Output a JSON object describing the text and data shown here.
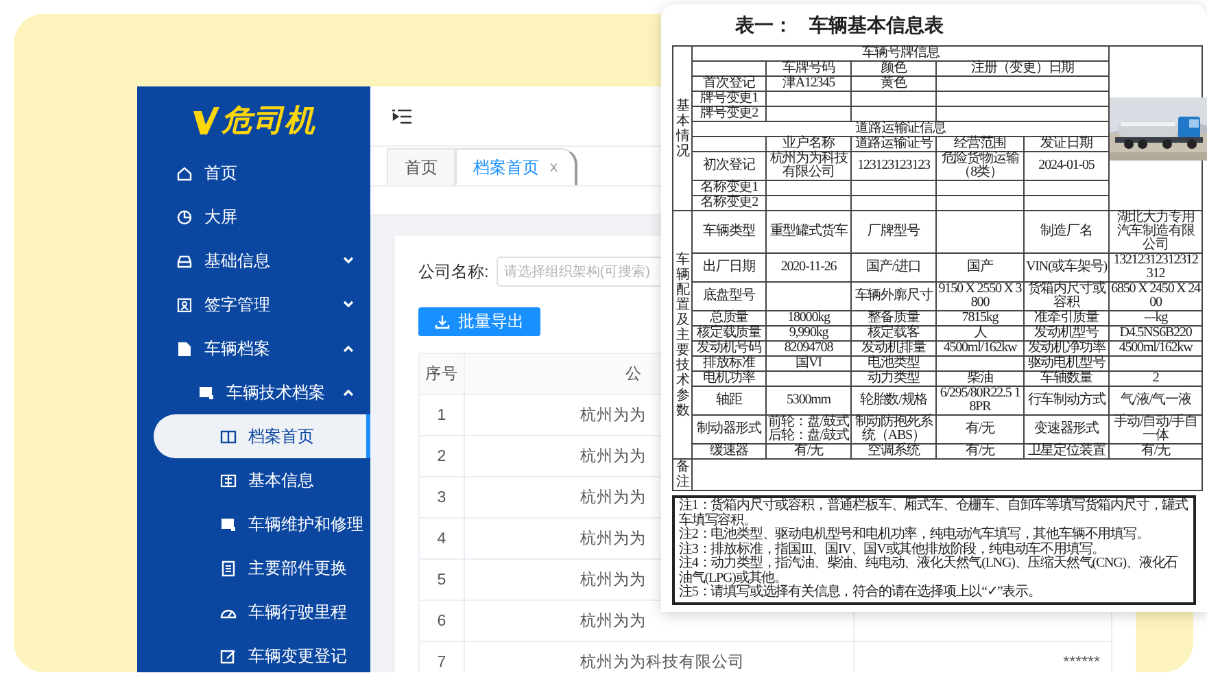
{
  "sidebar": {
    "logo": "危司机",
    "items": [
      {
        "label": "首页",
        "selected": false
      },
      {
        "label": "大屏",
        "selected": false
      },
      {
        "label": "基础信息",
        "selected": false,
        "expanded": false
      },
      {
        "label": "签字管理",
        "selected": false,
        "expanded": false
      },
      {
        "label": "车辆档案",
        "selected": false,
        "expanded": true,
        "children": [
          {
            "label": "车辆技术档案",
            "selected": false,
            "expanded": true,
            "children": [
              {
                "label": "档案首页",
                "selected": true
              },
              {
                "label": "基本信息",
                "selected": false
              },
              {
                "label": "车辆维护和修理",
                "selected": false
              },
              {
                "label": "主要部件更换",
                "selected": false
              },
              {
                "label": "车辆行驶里程",
                "selected": false
              },
              {
                "label": "车辆变更登记",
                "selected": false
              }
            ]
          }
        ]
      }
    ]
  },
  "tabs": [
    {
      "label": "首页",
      "selected": false
    },
    {
      "label": "档案首页",
      "selected": true,
      "close": "x"
    }
  ],
  "filter": {
    "label": "公司名称:",
    "placeholder": "请选择组织架构(可搜索)"
  },
  "export_button": {
    "label": "批量导出"
  },
  "table": {
    "columns": [
      "序号",
      "公"
    ],
    "rows": [
      {
        "index": "1",
        "company": "杭州为为"
      },
      {
        "index": "2",
        "company": "杭州为为"
      },
      {
        "index": "3",
        "company": "杭州为为"
      },
      {
        "index": "4",
        "company": "杭州为为"
      },
      {
        "index": "5",
        "company": "杭州为为"
      },
      {
        "index": "6",
        "company": "杭州为为"
      },
      {
        "index": "7",
        "company": "杭州为为科技有限公司",
        "column_3": "******"
      }
    ]
  },
  "document": {
    "title": "表一：",
    "subtitle": "车辆基本信息表",
    "basic_section": {
      "label": "基本情况",
      "plate_heading": "车辆号牌信息",
      "plate_columns": [
        "车牌号码",
        "颜色",
        "注册（变更）日期"
      ],
      "plate_rows": [
        {
          "label": "首次登记",
          "plate": "津A12345",
          "plate_color": "黄色"
        },
        {
          "label": "牌号变更1"
        },
        {
          "label": "牌号变更2"
        }
      ],
      "transport_heading": "道路运输证信息",
      "transport_columns": [
        "业户名称",
        "道路运输证号",
        "经营范围",
        "发证日期"
      ],
      "transport_rows": [
        {
          "label": "初次登记",
          "owner": "杭州为为科技有限公司",
          "permit": "123123123123",
          "scope": "危险货物运输（8类）",
          "date": "2024-01-05"
        },
        {
          "label": "名称变更1"
        },
        {
          "label": "名称变更2"
        }
      ]
    },
    "config_section": {
      "label": "车辆配置及主要技术参数",
      "rows": [
        [
          {
            "name": "车辆类型",
            "value": "重型罐式货车"
          },
          {
            "name": "厂牌型号"
          },
          {
            "name": "制造厂名",
            "value": "湖北大力专用汽车制造有限公司"
          }
        ],
        [
          {
            "name": "出厂日期",
            "value": "2020-11-26"
          },
          {
            "name": "国产/进口",
            "value": "国产"
          },
          {
            "name": "VIN(或车架号)",
            "value": "13212312312312312"
          }
        ],
        [
          {
            "name": "底盘型号"
          },
          {
            "name": "车辆外廓尺寸",
            "value": "9150 X 2550 X 3800"
          },
          {
            "name": "货箱内尺寸或容积",
            "value": "6850 X 2450 X 2400"
          }
        ],
        [
          {
            "name": "总质量",
            "value": "18000kg"
          },
          {
            "name": "整备质量",
            "value": "7815kg"
          },
          {
            "name": "准牵引质量",
            "value": "---kg"
          }
        ],
        [
          {
            "name": "核定载质量",
            "value": "9,990kg"
          },
          {
            "name": "核定载客",
            "value": "人"
          },
          {
            "name": "发动机型号",
            "value": "D4.5NS6B220"
          }
        ],
        [
          {
            "name": "发动机号码",
            "value": "82094708"
          },
          {
            "name": "发动机排量",
            "value": "4500ml/162kw"
          },
          {
            "name": "发动机净功率",
            "value": "4500ml/162kw"
          }
        ],
        [
          {
            "name": "排放标准",
            "value": "国VI"
          },
          {
            "name": "电池类型"
          },
          {
            "name": "驱动电机型号"
          }
        ],
        [
          {
            "name": "电机功率"
          },
          {
            "name": "动力类型",
            "value": "柴油"
          },
          {
            "name": "车轴数量",
            "value": "2"
          }
        ],
        [
          {
            "name": "轴距",
            "value": "5300mm"
          },
          {
            "name": "轮胎数/规格",
            "value": "6/295/80R22.5 18PR"
          },
          {
            "name": "行车制动方式",
            "value": "气/液/气一液"
          }
        ],
        [
          {
            "name": "制动器形式",
            "value": [
              "前轮：盘/鼓式",
              "后轮：盘/鼓式"
            ]
          },
          {
            "name": "制动防抱死系统（ABS）",
            "value": "有/无"
          },
          {
            "name": "变速器形式",
            "value": "手动/自动/手自一体"
          }
        ],
        [
          {
            "name": "缓速器",
            "value": "有/无"
          },
          {
            "name": "空调系统",
            "value": "有/无"
          },
          {
            "name": "卫星定位装置",
            "value": "有/无"
          }
        ]
      ]
    },
    "remarks": {
      "label": "备注"
    },
    "notes": [
      "注1：货箱内尺寸或容积，普通栏板车、厢式车、仓栅车、自卸车等填写货箱内尺寸，罐式车填写容积。",
      "注2：电池类型、驱动电机型号和电机功率，纯电动汽车填写，其他车辆不用填写。",
      "注3：排放标准，指国III、国IV、国V或其他排放阶段，纯电动车不用填写。",
      "注4：动力类型，指汽油、柴油、纯电动、液化天然气(LNG)、压缩天然气(CNG)、液化石油气(LPG)或其他。",
      "注5：请填写或选择有关信息，符合的请在选择项上以“✓”表示。"
    ]
  }
}
